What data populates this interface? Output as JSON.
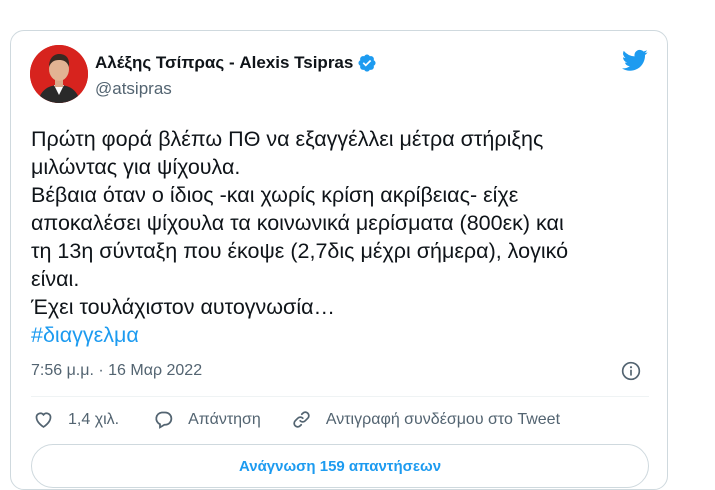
{
  "tweet": {
    "author_name": "Αλέξης Τσίπρας - Alexis Tsipras",
    "handle": "@atsipras",
    "text_lines": [
      "Πρώτη φορά βλέπω ΠΘ να εξαγγέλλει μέτρα στήριξης",
      "μιλώντας για ψίχουλα.",
      "Βέβαια όταν ο ίδιος -και χωρίς κρίση ακρίβειας- είχε",
      "αποκαλέσει ψίχουλα τα κοινωνικά μερίσματα (800εκ) και",
      "τη 13η σύνταξη που έκοψε (2,7δις μέχρι σήμερα), λογικό",
      "είναι.",
      "Έχει τουλάχιστον αυτογνωσία…"
    ],
    "hashtag": "#διαγγελμα",
    "timestamp": "7:56 μ.μ. · 16 Μαρ 2022"
  },
  "actions": {
    "like_count": "1,4 χιλ.",
    "reply_label": "Απάντηση",
    "copy_link_label": "Αντιγραφή συνδέσμου στο Tweet"
  },
  "read_replies_label": "Ανάγνωση 159 απαντήσεων",
  "icons": {
    "verified": "verified-badge-icon",
    "twitter": "twitter-bird-icon",
    "info": "info-icon",
    "like": "heart-icon",
    "reply": "speech-bubble-icon",
    "copy_link": "link-icon"
  },
  "colors": {
    "accent": "#1d9bf0",
    "text": "#0f1419",
    "secondary": "#536471",
    "avatar_bg": "#d7231e"
  }
}
